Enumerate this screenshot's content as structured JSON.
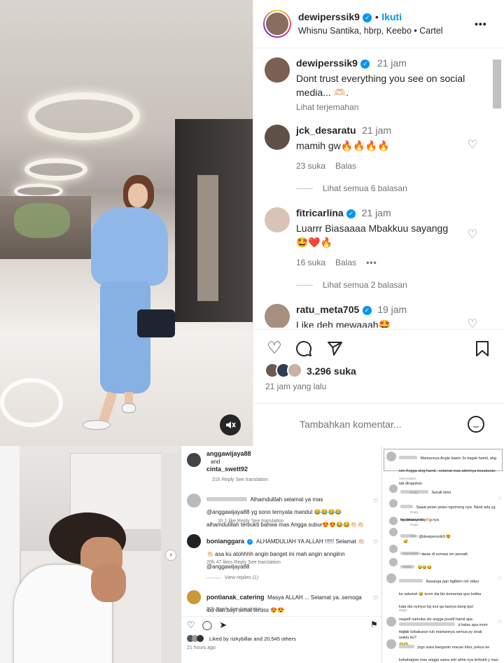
{
  "post": {
    "username": "dewiperssik9",
    "follow_label": "Ikuti",
    "location": "Whisnu Santika, hbrp, Keebo • Cartel",
    "more_icon": "•••",
    "caption_username": "dewiperssik9",
    "caption_time": "21 jam",
    "caption_text": "Dont trust everything you see on social media... 🫶🏻.",
    "translate_label": "Lihat terjemahan",
    "likes": "3.296 suka",
    "post_time": "21 jam yang lalu",
    "add_comment_placeholder": "Tambahkan komentar...",
    "mute_icon": "speaker-muted-icon"
  },
  "comments": [
    {
      "username": "jck_desaratu",
      "time": "21 jam",
      "text": "mamih gw🔥🔥🔥🔥",
      "likes": "23 suka",
      "reply": "Balas",
      "view_replies": "Lihat semua 6 balasan"
    },
    {
      "username": "fitricarlina",
      "time": "21 jam",
      "text": "Luarrr Biasaaaa Mbakkuu sayangg 🤩❤️🔥",
      "likes": "16 suka",
      "reply": "Balas",
      "more": "•••",
      "view_replies": "Lihat semua 2 balasan"
    },
    {
      "username": "ratu_meta705",
      "time": "19 jam",
      "text": "Like deh mewaaah🤩"
    }
  ],
  "bottom_mid": {
    "header_user1": "anggawijaya88",
    "header_and": "and",
    "header_user2": "cinta_swett92",
    "header_meta": "21h  Reply  See translation",
    "comments": [
      {
        "text": "Alhamdulilah selamat ya mas @anggawijaya88 yg sono ternyata mandul 😂😂😂😂 alhamdulillah terbukti bahwa mas Angga subur😍😍😂😂👏🏻👏🏻",
        "meta": "1h  1 like  Reply  See translation"
      },
      {
        "username": "bonianggara",
        "text": "ALHAMDULIAH YA ALLAH !!!!!! Selamat 👏🏻👏🏻 asa ku atohhhh angin banget ini mah angin anngiinn @anggawijaya88",
        "meta": "20h  47 likes  Reply  See translation",
        "view_replies": "View replies (1)"
      },
      {
        "username": "pontianak_catering",
        "text": "Masya ALLAH ... Selamat ya..semoga ibu dan bayi sehat teruss 😍😍",
        "meta": "20h  Reply  See translation"
      }
    ],
    "liked_by": "Liked by rizkybillar and 20,545 others",
    "time": "21 hours ago"
  },
  "bottom_right": {
    "comments": [
      {
        "text": "Mantannya Angle kawin 3x kagak hamil, ahg istri Angga skrg hamil.. selamat mas akhirnya kesuburan tak diragukan",
        "meta": "View replies"
      },
      {
        "text": "Setulll hihiii",
        "meta": "Reply"
      },
      {
        "text": "Saaat pelan pelan ngomong nya. Nanti ada yg kepanasan kuping nya",
        "meta": "Reply"
      },
      {
        "text": "nyolehanyneh 👏🏻",
        "meta": "Reply"
      },
      {
        "text": "@dewiperssik9 😍",
        "meta": "Reply"
      },
      {
        "text": "😅",
        "meta": ""
      },
      {
        "text": "awas di somasi sm persaik",
        "meta": "See translation"
      },
      {
        "text": "😂😂😂",
        "meta": "Reply"
      },
      {
        "text": "Rasanga pgn bgtbkm nih video ke sebelah 😂 kmrn dia bls komentar gue ketika kata dia nyinyur bg ioul ga taunya bang ipul negatif narkoba skr angga positif hamil apa kagak kebakaran tuh mantannya semua py anak😂😂",
        "meta": "Reply"
      },
      {
        "text": "d balas apa mom waktu itu?",
        "meta": "Reply"
      },
      {
        "text": "jngn suka bangunin macan tidur, pokus ke kebahagian mas angga sama istri akhir nya terbukti y mas",
        "meta": ""
      }
    ]
  },
  "colors": {
    "accent": "#0095f6",
    "text": "#262626",
    "muted": "#737373"
  }
}
